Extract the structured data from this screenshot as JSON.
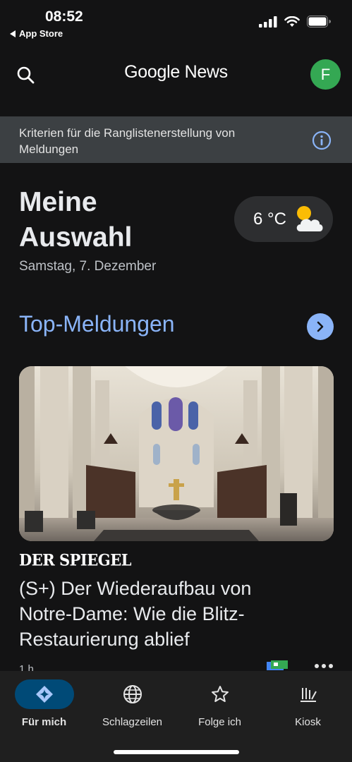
{
  "status_bar": {
    "time": "08:52",
    "back_app": "App Store"
  },
  "header": {
    "brand": "Google News",
    "avatar_initial": "F"
  },
  "criteria_banner": {
    "text": "Kriterien für die Ranglistenerstellung von Meldungen"
  },
  "greeting": {
    "title": "Meine Auswahl",
    "date": "Samstag, 7. Dezember"
  },
  "weather": {
    "temperature": "6 °C",
    "icon": "partly-cloudy-icon"
  },
  "section": {
    "title": "Top-Meldungen"
  },
  "article": {
    "source": "DER SPIEGEL",
    "headline": "(S+) Der Wiederaufbau von Notre-Dame: Wie die Blitz-Restaurierung ablief",
    "age": "1 h"
  },
  "bottom_nav": [
    {
      "label": "Für mich",
      "icon": "for-you-icon",
      "active": true
    },
    {
      "label": "Schlagzeilen",
      "icon": "globe-icon",
      "active": false
    },
    {
      "label": "Folge ich",
      "icon": "star-icon",
      "active": false
    },
    {
      "label": "Kiosk",
      "icon": "newsstand-icon",
      "active": false
    }
  ],
  "colors": {
    "background": "#131314",
    "accent": "#8ab4f8",
    "avatar": "#34a853",
    "active_pill": "#004a77"
  }
}
